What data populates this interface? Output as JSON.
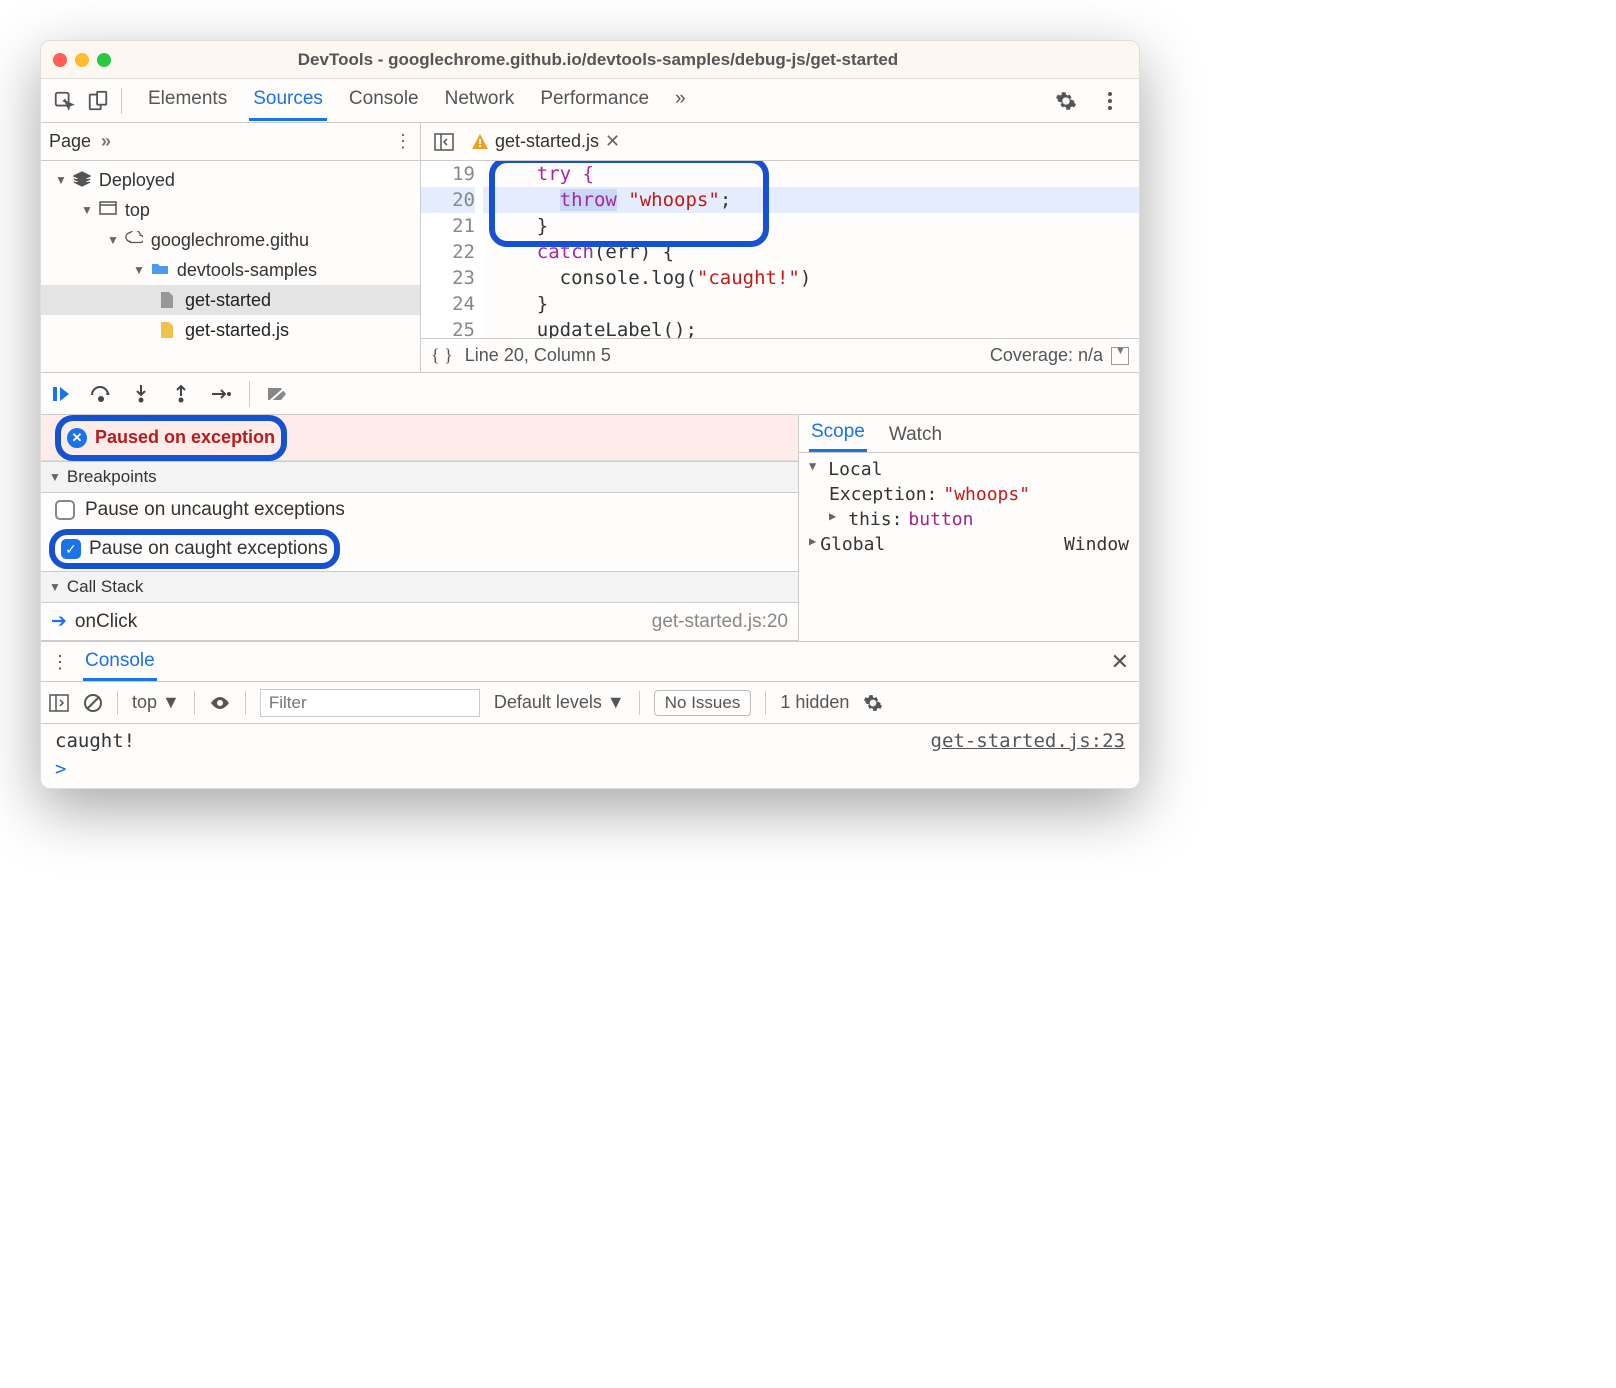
{
  "window": {
    "title": "DevTools - googlechrome.github.io/devtools-samples/debug-js/get-started"
  },
  "mainTabs": {
    "items": [
      "Elements",
      "Sources",
      "Console",
      "Network",
      "Performance"
    ],
    "more": "»"
  },
  "navigator": {
    "pageLabel": "Page",
    "more": "»",
    "tree": {
      "root": "Deployed",
      "top": "top",
      "origin": "googlechrome.githu",
      "folder": "devtools-samples",
      "file1": "get-started",
      "file2": "get-started.js"
    }
  },
  "editor": {
    "fileName": "get-started.js",
    "lines": {
      "n19": "19",
      "c19": "try {",
      "n20": "20",
      "c20a": "throw",
      "c20b": "\"whoops\"",
      "c20c": ";",
      "n21": "21",
      "c21": "}",
      "n22": "22",
      "c22a": "catch",
      "c22b": "(err) {",
      "n23": "23",
      "c23a": "console.log(",
      "c23b": "\"caught!\"",
      "c23c": ")",
      "n24": "24",
      "c24": "}",
      "n25": "25",
      "c25": "updateLabel();"
    },
    "status": {
      "position": "Line 20, Column 5",
      "coverage": "Coverage: n/a"
    }
  },
  "debugger": {
    "pausedMsg": "Paused on exception",
    "breakpointsHeader": "Breakpoints",
    "pauseUncaught": "Pause on uncaught exceptions",
    "pauseCaught": "Pause on caught exceptions",
    "callStackHeader": "Call Stack",
    "frame": {
      "name": "onClick",
      "loc": "get-started.js:20"
    }
  },
  "scope": {
    "tabs": {
      "scope": "Scope",
      "watch": "Watch"
    },
    "localHeader": "Local",
    "exceptionLabel": "Exception:",
    "exceptionValue": "\"whoops\"",
    "thisLabel": "this:",
    "thisValue": "button",
    "globalLabel": "Global",
    "globalValue": "Window"
  },
  "drawer": {
    "more": "⋮",
    "tab": "Console",
    "context": "top",
    "filterPlaceholder": "Filter",
    "levels": "Default levels",
    "noIssues": "No Issues",
    "hidden": "1 hidden",
    "log": {
      "msg": "caught!",
      "loc": "get-started.js:23"
    },
    "prompt": ">"
  }
}
